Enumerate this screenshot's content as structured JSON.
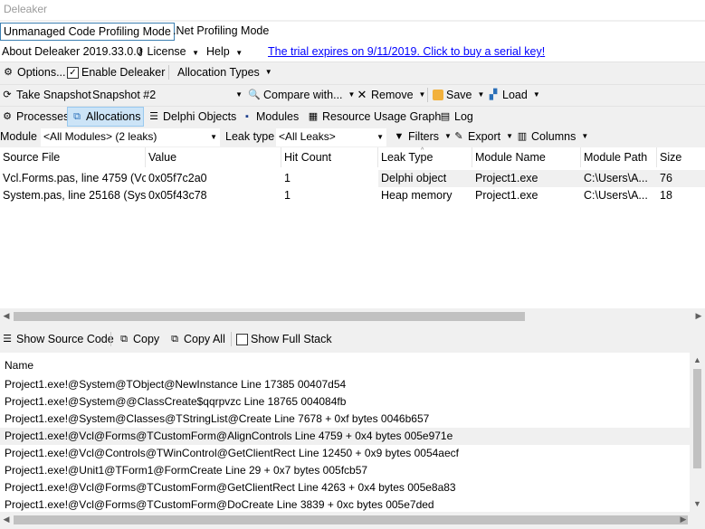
{
  "window": {
    "title": "Deleaker"
  },
  "modes": {
    "unmanaged": "Unmanaged Code Profiling Mode",
    "dotnet": ".Net Profiling Mode"
  },
  "menubar": {
    "about": "About Deleaker 2019.33.0.0",
    "license": "License",
    "help": "Help",
    "trial": "The trial expires on 9/11/2019. Click to buy a serial key!"
  },
  "toolbar1": {
    "options": "Options...",
    "enable": "Enable Deleaker",
    "allocation_types": "Allocation Types"
  },
  "toolbar2": {
    "take_snapshot": "Take Snapshot",
    "snapshot_value": "Snapshot #2",
    "compare": "Compare with...",
    "remove": "Remove",
    "save": "Save",
    "load": "Load"
  },
  "tabs": [
    "Processes",
    "Allocations",
    "Delphi Objects",
    "Modules",
    "Resource Usage Graph",
    "Log"
  ],
  "filters": {
    "module_label": "Module",
    "module_value": "<All Modules> (2 leaks)",
    "leaktype_label": "Leak type",
    "leaktype_value": "<All Leaks>",
    "filters": "Filters",
    "export": "Export",
    "columns": "Columns"
  },
  "grid": {
    "headers": [
      "Source File",
      "Value",
      "Hit Count",
      "Leak Type",
      "Module Name",
      "Module Path",
      "Size"
    ],
    "rows": [
      [
        "Vcl.Forms.pas, line 4759 (Vcl...",
        "0x05f7c2a0",
        "1",
        "Delphi object",
        "Project1.exe",
        "C:\\Users\\A...",
        "76"
      ],
      [
        "System.pas, line 25168 (Syst...",
        "0x05f43c78",
        "1",
        "Heap memory",
        "Project1.exe",
        "C:\\Users\\A...",
        "18"
      ]
    ]
  },
  "stack_toolbar": {
    "show_source": "Show Source Code",
    "copy": "Copy",
    "copy_all": "Copy All",
    "show_full": "Show Full Stack"
  },
  "stack": {
    "header": "Name",
    "rows": [
      "Project1.exe!@System@TObject@NewInstance Line 17385 00407d54",
      "Project1.exe!@System@@ClassCreate$qqrpvzc Line 18765 004084fb",
      "Project1.exe!@System@Classes@TStringList@Create Line 7678 + 0xf bytes 0046b657",
      "Project1.exe!@Vcl@Forms@TCustomForm@AlignControls Line 4759 + 0x4 bytes 005e971e",
      "Project1.exe!@Vcl@Controls@TWinControl@GetClientRect Line 12450 + 0x9 bytes 0054aecf",
      "Project1.exe!@Unit1@TForm1@FormCreate Line 29 + 0x7 bytes 005fcb57",
      "Project1.exe!@Vcl@Forms@TCustomForm@GetClientRect Line 4263 + 0x4 bytes 005e8a83",
      "Project1.exe!@Vcl@Forms@TCustomForm@DoCreate Line 3839 + 0xc bytes 005e7ded"
    ]
  }
}
